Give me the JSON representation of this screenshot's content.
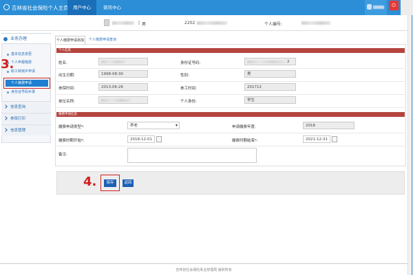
{
  "header": {
    "title": "吉林省社会保险个人主页",
    "tabs": [
      {
        "label": "用户中心",
        "active": true
      },
      {
        "label": "资讯中心",
        "active": false
      }
    ],
    "logout_symbol": "⏻"
  },
  "colors": {
    "header_blue": "#2b8ed6",
    "section_red": "#b5443f",
    "button_blue": "#1a5fb4",
    "annotation_red": "#d11f1f"
  },
  "info_bar": {
    "separator": "|",
    "gender": "男",
    "id_number_prefix": "2202",
    "person_number_label": "个人编号:"
  },
  "sidebar": {
    "section_title": "业务办理",
    "items": [
      {
        "label": "基本信息变更",
        "selected": false
      },
      {
        "label": "个人申报缴费",
        "selected": false
      },
      {
        "label": "职工转城乡申请",
        "selected": false
      },
      {
        "label": "个人缴费申请",
        "selected": true
      },
      {
        "label": "身份证号码补录",
        "selected": false
      }
    ],
    "groups": [
      "信息查询",
      "参保打印",
      "信息管理"
    ]
  },
  "main": {
    "tabs": [
      "个人缴费申请添加",
      "个人缴费申请查询"
    ],
    "personal_info": {
      "title": "个人信息",
      "name_label": "姓名:",
      "id_label": "身份证号码:",
      "id_suffix": "2",
      "birth_label": "出生日期:",
      "birth_value": "1998-08-30",
      "gender_label": "性别:",
      "gender_value": "男",
      "insured_label": "参保时间:",
      "insured_value": "2013-06-26",
      "work_label": "参工时间:",
      "work_value": "201712",
      "unit_label": "单位名称:",
      "identity_label": "个人身份:",
      "identity_value": "学生"
    },
    "payment": {
      "title": "缴费申请信息",
      "type_label": "缴费申请类型*:",
      "type_value": "养老",
      "year_label": "申请缴费年度:",
      "year_value": "2018",
      "start_label": "缴费时期开始*:",
      "start_value": "2018-12-01",
      "end_label": "缴费时期结束*:",
      "end_value": "2021-12-31",
      "remark_label": "备注:"
    },
    "buttons": {
      "save": "保存",
      "back": "返回"
    }
  },
  "annotations": {
    "step3": "3.",
    "step4": "4."
  },
  "footer": {
    "text": "吉林省社会保险事业管理局 版权所有"
  }
}
